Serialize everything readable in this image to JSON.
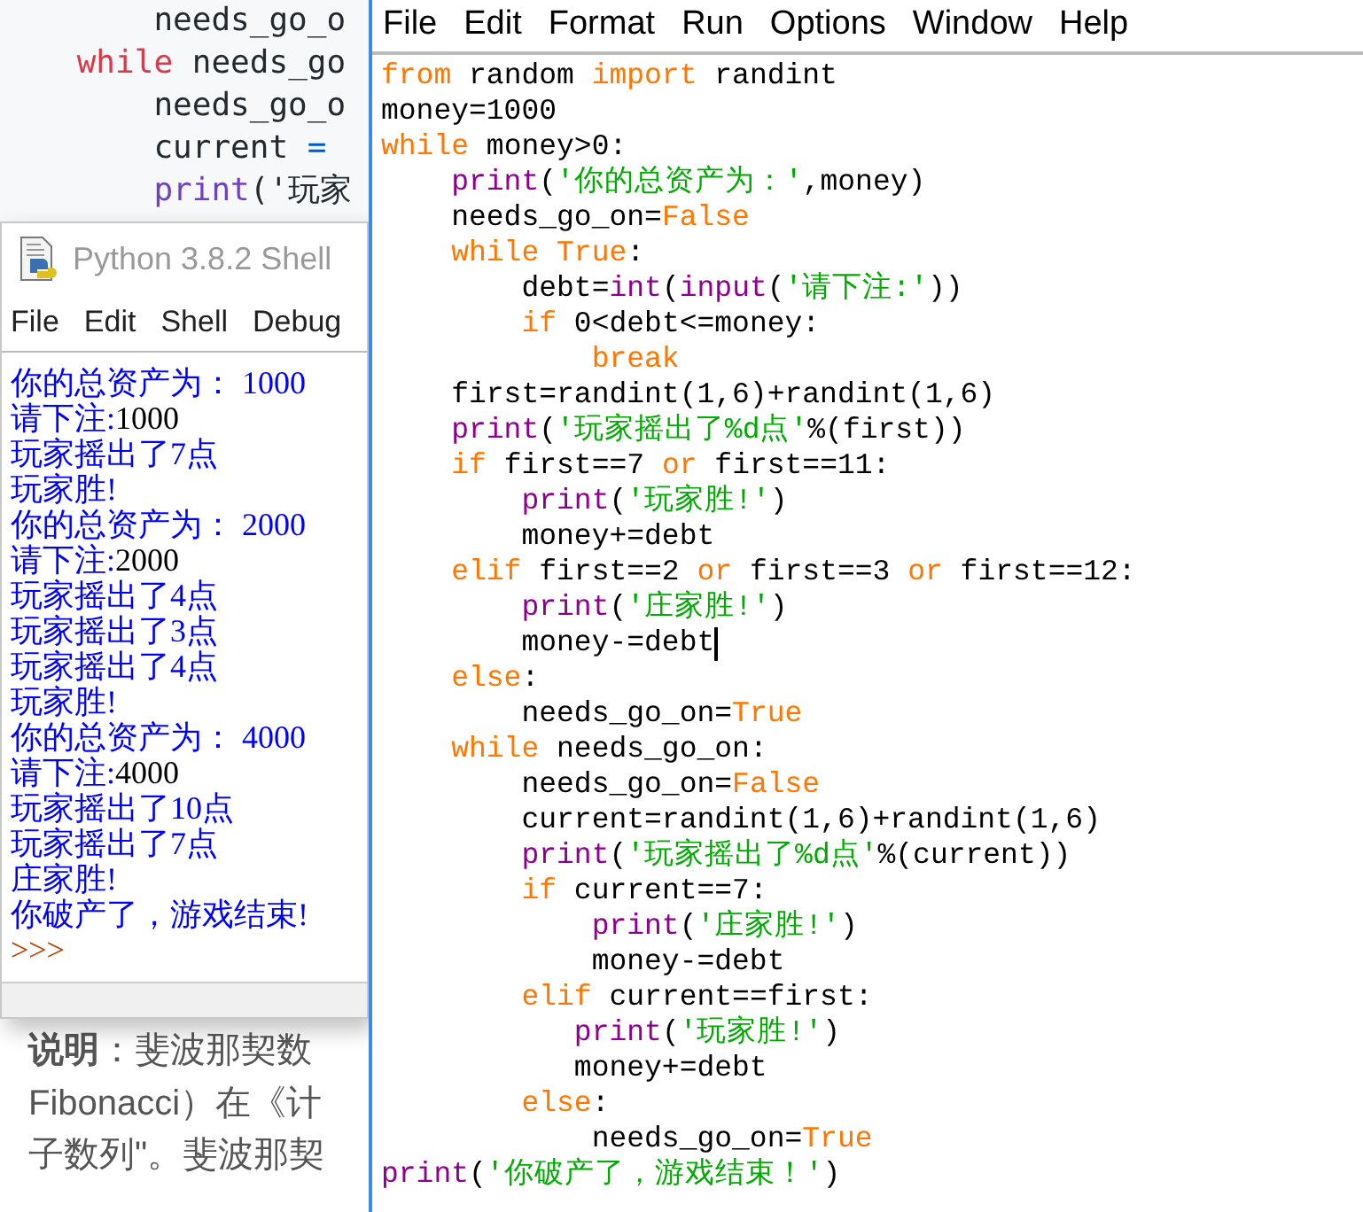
{
  "background_code": {
    "lines": [
      {
        "segments": [
          {
            "kind": "plain",
            "text": "        needs_go_o"
          }
        ]
      },
      {
        "segments": [
          {
            "kind": "keyword",
            "text": "    while"
          },
          {
            "kind": "plain",
            "text": " needs_go"
          }
        ]
      },
      {
        "segments": [
          {
            "kind": "plain",
            "text": "        needs_go_o"
          }
        ]
      },
      {
        "segments": [
          {
            "kind": "plain",
            "text": "        current "
          },
          {
            "kind": "operator",
            "text": "="
          }
        ]
      },
      {
        "segments": [
          {
            "kind": "builtin",
            "text": "        print"
          },
          {
            "kind": "plain",
            "text": "('玩家"
          }
        ]
      }
    ]
  },
  "shell": {
    "title": "Python 3.8.2 Shell",
    "menu": [
      "File",
      "Edit",
      "Shell",
      "Debug"
    ],
    "lines": [
      {
        "segments": [
          {
            "kind": "stdout",
            "text": "你的总资产为： 1000"
          }
        ]
      },
      {
        "segments": [
          {
            "kind": "stdout",
            "text": "请下注:"
          },
          {
            "kind": "stdin",
            "text": "1000"
          }
        ]
      },
      {
        "segments": [
          {
            "kind": "stdout",
            "text": "玩家摇出了7点"
          }
        ]
      },
      {
        "segments": [
          {
            "kind": "stdout",
            "text": "玩家胜!"
          }
        ]
      },
      {
        "segments": [
          {
            "kind": "stdout",
            "text": "你的总资产为： 2000"
          }
        ]
      },
      {
        "segments": [
          {
            "kind": "stdout",
            "text": "请下注:"
          },
          {
            "kind": "stdin",
            "text": "2000"
          }
        ]
      },
      {
        "segments": [
          {
            "kind": "stdout",
            "text": "玩家摇出了4点"
          }
        ]
      },
      {
        "segments": [
          {
            "kind": "stdout",
            "text": "玩家摇出了3点"
          }
        ]
      },
      {
        "segments": [
          {
            "kind": "stdout",
            "text": "玩家摇出了4点"
          }
        ]
      },
      {
        "segments": [
          {
            "kind": "stdout",
            "text": "玩家胜!"
          }
        ]
      },
      {
        "segments": [
          {
            "kind": "stdout",
            "text": "你的总资产为： 4000"
          }
        ]
      },
      {
        "segments": [
          {
            "kind": "stdout",
            "text": "请下注:"
          },
          {
            "kind": "stdin",
            "text": "4000"
          }
        ]
      },
      {
        "segments": [
          {
            "kind": "stdout",
            "text": "玩家摇出了10点"
          }
        ]
      },
      {
        "segments": [
          {
            "kind": "stdout",
            "text": "玩家摇出了7点"
          }
        ]
      },
      {
        "segments": [
          {
            "kind": "stdout",
            "text": "庄家胜!"
          }
        ]
      },
      {
        "segments": [
          {
            "kind": "stdout",
            "text": "你破产了，游戏结束!"
          }
        ]
      },
      {
        "segments": [
          {
            "kind": "prompt",
            "text": ">>>"
          }
        ]
      }
    ]
  },
  "article": {
    "lines": [
      "**说明**：斐波那契数",
      "Fibonacci）在《计",
      "子数列\"。斐波那契"
    ]
  },
  "editor": {
    "menu": [
      "File",
      "Edit",
      "Format",
      "Run",
      "Options",
      "Window",
      "Help"
    ],
    "lines": [
      {
        "cursor": false,
        "segments": [
          {
            "kind": "keyword",
            "text": "from"
          },
          {
            "kind": "plain",
            "text": " random "
          },
          {
            "kind": "keyword",
            "text": "import"
          },
          {
            "kind": "plain",
            "text": " randint"
          }
        ]
      },
      {
        "cursor": false,
        "segments": [
          {
            "kind": "plain",
            "text": "money=1000"
          }
        ]
      },
      {
        "cursor": false,
        "segments": [
          {
            "kind": "keyword",
            "text": "while"
          },
          {
            "kind": "plain",
            "text": " money>0:"
          }
        ]
      },
      {
        "cursor": false,
        "segments": [
          {
            "kind": "builtin",
            "text": "    print"
          },
          {
            "kind": "plain",
            "text": "("
          },
          {
            "kind": "string",
            "text": "'你的总资产为：'"
          },
          {
            "kind": "plain",
            "text": ",money)"
          }
        ]
      },
      {
        "cursor": false,
        "segments": [
          {
            "kind": "plain",
            "text": "    needs_go_on="
          },
          {
            "kind": "keyword",
            "text": "False"
          }
        ]
      },
      {
        "cursor": false,
        "segments": [
          {
            "kind": "keyword",
            "text": "    while True"
          },
          {
            "kind": "plain",
            "text": ":"
          }
        ]
      },
      {
        "cursor": false,
        "segments": [
          {
            "kind": "plain",
            "text": "        debt="
          },
          {
            "kind": "builtin",
            "text": "int"
          },
          {
            "kind": "plain",
            "text": "("
          },
          {
            "kind": "builtin",
            "text": "input"
          },
          {
            "kind": "plain",
            "text": "("
          },
          {
            "kind": "string",
            "text": "'请下注:'"
          },
          {
            "kind": "plain",
            "text": "))"
          }
        ]
      },
      {
        "cursor": false,
        "segments": [
          {
            "kind": "keyword",
            "text": "        if"
          },
          {
            "kind": "plain",
            "text": " 0<debt<=money:"
          }
        ]
      },
      {
        "cursor": false,
        "segments": [
          {
            "kind": "keyword",
            "text": "            break"
          }
        ]
      },
      {
        "cursor": false,
        "segments": [
          {
            "kind": "plain",
            "text": "    first=randint(1,6)+randint(1,6)"
          }
        ]
      },
      {
        "cursor": false,
        "segments": [
          {
            "kind": "builtin",
            "text": "    print"
          },
          {
            "kind": "plain",
            "text": "("
          },
          {
            "kind": "string",
            "text": "'玩家摇出了%d点'"
          },
          {
            "kind": "plain",
            "text": "%(first))"
          }
        ]
      },
      {
        "cursor": false,
        "segments": [
          {
            "kind": "keyword",
            "text": "    if"
          },
          {
            "kind": "plain",
            "text": " first==7 "
          },
          {
            "kind": "keyword",
            "text": "or"
          },
          {
            "kind": "plain",
            "text": " first==11:"
          }
        ]
      },
      {
        "cursor": false,
        "segments": [
          {
            "kind": "builtin",
            "text": "        print"
          },
          {
            "kind": "plain",
            "text": "("
          },
          {
            "kind": "string",
            "text": "'玩家胜!'"
          },
          {
            "kind": "plain",
            "text": ")"
          }
        ]
      },
      {
        "cursor": false,
        "segments": [
          {
            "kind": "plain",
            "text": "        money+=debt"
          }
        ]
      },
      {
        "cursor": false,
        "segments": [
          {
            "kind": "keyword",
            "text": "    elif"
          },
          {
            "kind": "plain",
            "text": " first==2 "
          },
          {
            "kind": "keyword",
            "text": "or"
          },
          {
            "kind": "plain",
            "text": " first==3 "
          },
          {
            "kind": "keyword",
            "text": "or"
          },
          {
            "kind": "plain",
            "text": " first==12:"
          }
        ]
      },
      {
        "cursor": false,
        "segments": [
          {
            "kind": "builtin",
            "text": "        print"
          },
          {
            "kind": "plain",
            "text": "("
          },
          {
            "kind": "string",
            "text": "'庄家胜!'"
          },
          {
            "kind": "plain",
            "text": ")"
          }
        ]
      },
      {
        "cursor": true,
        "segments": [
          {
            "kind": "plain",
            "text": "        money-=debt"
          }
        ]
      },
      {
        "cursor": false,
        "segments": [
          {
            "kind": "keyword",
            "text": "    else"
          },
          {
            "kind": "plain",
            "text": ":"
          }
        ]
      },
      {
        "cursor": false,
        "segments": [
          {
            "kind": "plain",
            "text": "        needs_go_on="
          },
          {
            "kind": "keyword",
            "text": "True"
          }
        ]
      },
      {
        "cursor": false,
        "segments": [
          {
            "kind": "keyword",
            "text": "    while"
          },
          {
            "kind": "plain",
            "text": " needs_go_on:"
          }
        ]
      },
      {
        "cursor": false,
        "segments": [
          {
            "kind": "plain",
            "text": "        needs_go_on="
          },
          {
            "kind": "keyword",
            "text": "False"
          }
        ]
      },
      {
        "cursor": false,
        "segments": [
          {
            "kind": "plain",
            "text": "        current=randint(1,6)+randint(1,6)"
          }
        ]
      },
      {
        "cursor": false,
        "segments": [
          {
            "kind": "builtin",
            "text": "        print"
          },
          {
            "kind": "plain",
            "text": "("
          },
          {
            "kind": "string",
            "text": "'玩家摇出了%d点'"
          },
          {
            "kind": "plain",
            "text": "%(current))"
          }
        ]
      },
      {
        "cursor": false,
        "segments": [
          {
            "kind": "keyword",
            "text": "        if"
          },
          {
            "kind": "plain",
            "text": " current==7:"
          }
        ]
      },
      {
        "cursor": false,
        "segments": [
          {
            "kind": "builtin",
            "text": "            print"
          },
          {
            "kind": "plain",
            "text": "("
          },
          {
            "kind": "string",
            "text": "'庄家胜!'"
          },
          {
            "kind": "plain",
            "text": ")"
          }
        ]
      },
      {
        "cursor": false,
        "segments": [
          {
            "kind": "plain",
            "text": "            money-=debt"
          }
        ]
      },
      {
        "cursor": false,
        "segments": [
          {
            "kind": "keyword",
            "text": "        elif"
          },
          {
            "kind": "plain",
            "text": " current==first:"
          }
        ]
      },
      {
        "cursor": false,
        "segments": [
          {
            "kind": "builtin",
            "text": "           print"
          },
          {
            "kind": "plain",
            "text": "("
          },
          {
            "kind": "string",
            "text": "'玩家胜!'"
          },
          {
            "kind": "plain",
            "text": ")"
          }
        ]
      },
      {
        "cursor": false,
        "segments": [
          {
            "kind": "plain",
            "text": "           money+=debt"
          }
        ]
      },
      {
        "cursor": false,
        "segments": [
          {
            "kind": "keyword",
            "text": "        else"
          },
          {
            "kind": "plain",
            "text": ":"
          }
        ]
      },
      {
        "cursor": false,
        "segments": [
          {
            "kind": "plain",
            "text": "            needs_go_on="
          },
          {
            "kind": "keyword",
            "text": "True"
          }
        ]
      },
      {
        "cursor": false,
        "segments": [
          {
            "kind": "builtin",
            "text": "print"
          },
          {
            "kind": "plain",
            "text": "("
          },
          {
            "kind": "string",
            "text": "'你破产了，游戏结束！'"
          },
          {
            "kind": "plain",
            "text": ")"
          }
        ]
      }
    ]
  }
}
